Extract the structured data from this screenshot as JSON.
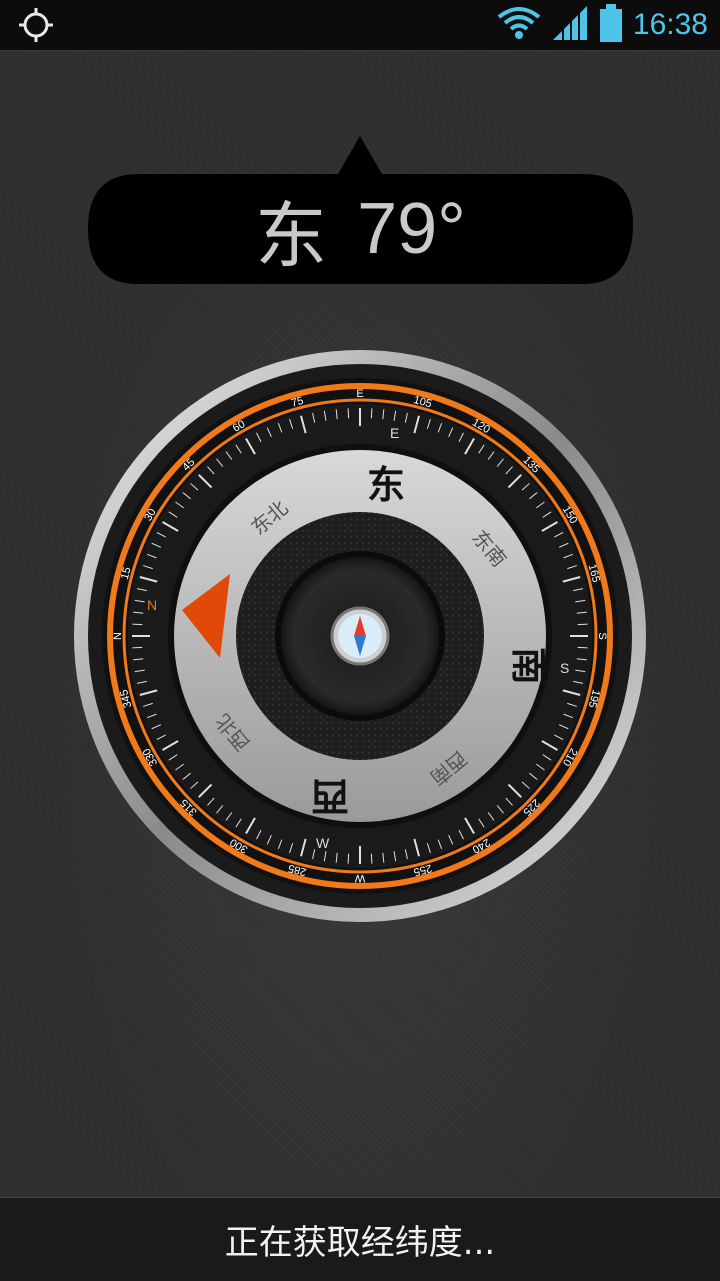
{
  "status_bar": {
    "left_icon": "gps-crosshair-icon",
    "time": "16:38",
    "icons": [
      "wifi-icon",
      "signal-icon",
      "battery-icon"
    ]
  },
  "heading": {
    "direction": "东",
    "degrees": "79°"
  },
  "compass": {
    "accent_color": "#f07a1a",
    "big_labels": {
      "north_slot": "东",
      "east_slot": "南",
      "south_slot": "西"
    },
    "small_labels": {
      "nw_slot": "东北",
      "ne_slot": "东南",
      "se_slot": "西南",
      "sw_slot": "西北"
    },
    "ring_letters": {
      "top": "E",
      "right": "S",
      "bottom": "W",
      "left": "N"
    },
    "tick_numbers": [
      "15",
      "30",
      "45",
      "60",
      "75",
      "105",
      "120",
      "135",
      "150",
      "165",
      "195",
      "210",
      "225",
      "240",
      "255",
      "285",
      "300",
      "315",
      "330",
      "345"
    ],
    "ring_cardinals": [
      "E",
      "S",
      "W",
      "N"
    ],
    "center_icon": "mini-compass-icon",
    "pointer_icon": "orange-triangle-pointer-icon"
  },
  "bottom": {
    "status_text": "正在获取经纬度..."
  }
}
